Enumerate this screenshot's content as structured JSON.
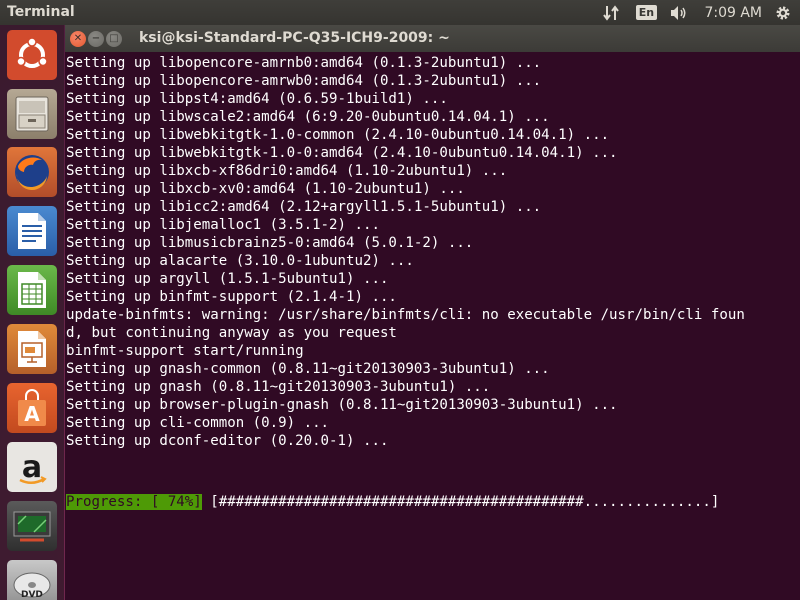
{
  "panel": {
    "app_title": "Terminal",
    "keyboard_layout": "En",
    "clock": "7:09 AM",
    "icons": [
      "network-updown-icon",
      "keyboard-icon",
      "volume-icon",
      "gear-icon"
    ]
  },
  "launcher": {
    "items": [
      {
        "name": "ubuntu-dash",
        "icon": "ubuntu-logo-icon"
      },
      {
        "name": "files",
        "icon": "file-cabinet-icon"
      },
      {
        "name": "firefox",
        "icon": "firefox-icon"
      },
      {
        "name": "libreoffice-writer",
        "icon": "writer-icon"
      },
      {
        "name": "libreoffice-calc",
        "icon": "calc-icon"
      },
      {
        "name": "libreoffice-impress",
        "icon": "impress-icon"
      },
      {
        "name": "ubuntu-software",
        "icon": "shopping-bag-icon"
      },
      {
        "name": "amazon",
        "icon": "amazon-icon"
      },
      {
        "name": "workspace-switcher",
        "icon": "workspace-icon"
      },
      {
        "name": "dvd",
        "icon": "dvd-icon",
        "label": "DVD"
      }
    ]
  },
  "window": {
    "title": "ksi@ksi-Standard-PC-Q35-ICH9-2009: ~",
    "close_glyph": "✕",
    "minimize_glyph": "−",
    "maximize_glyph": "□"
  },
  "terminal": {
    "lines": [
      "Setting up libopencore-amrnb0:amd64 (0.1.3-2ubuntu1) ...",
      "Setting up libopencore-amrwb0:amd64 (0.1.3-2ubuntu1) ...",
      "Setting up libpst4:amd64 (0.6.59-1build1) ...",
      "Setting up libwscale2:amd64 (6:9.20-0ubuntu0.14.04.1) ...",
      "Setting up libwebkitgtk-1.0-common (2.4.10-0ubuntu0.14.04.1) ...",
      "Setting up libwebkitgtk-1.0-0:amd64 (2.4.10-0ubuntu0.14.04.1) ...",
      "Setting up libxcb-xf86dri0:amd64 (1.10-2ubuntu1) ...",
      "Setting up libxcb-xv0:amd64 (1.10-2ubuntu1) ...",
      "Setting up libicc2:amd64 (2.12+argyll1.5.1-5ubuntu1) ...",
      "Setting up libjemalloc1 (3.5.1-2) ...",
      "Setting up libmusicbrainz5-0:amd64 (5.0.1-2) ...",
      "Setting up alacarte (3.10.0-1ubuntu2) ...",
      "Setting up argyll (1.5.1-5ubuntu1) ...",
      "Setting up binfmt-support (2.1.4-1) ...",
      "update-binfmts: warning: /usr/share/binfmts/cli: no executable /usr/bin/cli foun",
      "d, but continuing anyway as you request",
      "binfmt-support start/running",
      "Setting up gnash-common (0.8.11~git20130903-3ubuntu1) ...",
      "Setting up gnash (0.8.11~git20130903-3ubuntu1) ...",
      "Setting up browser-plugin-gnash (0.8.11~git20130903-3ubuntu1) ...",
      "Setting up cli-common (0.9) ...",
      "Setting up dconf-editor (0.20.0-1) ..."
    ],
    "progress_label": "Progress: [ 74%]",
    "progress_bar": " [###########################################...............]",
    "progress_percent": 74
  },
  "colors": {
    "terminal_bg": "#300a24",
    "panel_bg": "#3c3b37",
    "progress_green": "#4e9a06",
    "close_orange": "#e3592f"
  }
}
